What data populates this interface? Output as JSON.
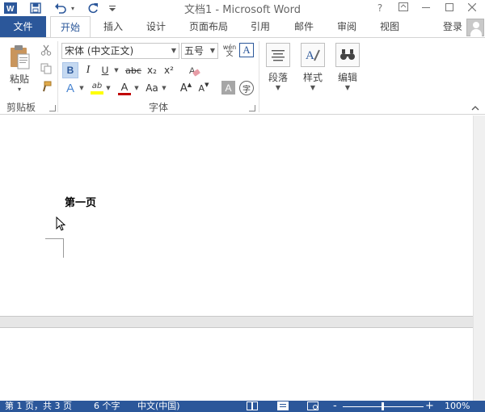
{
  "title_bar": {
    "title": "文档1 - Microsoft Word",
    "help": "?",
    "quick_access": [
      "word-app-icon",
      "save-icon",
      "undo-icon",
      "redo-icon",
      "customize-icon"
    ]
  },
  "tabs": {
    "file": "文件",
    "items": [
      "开始",
      "插入",
      "设计",
      "页面布局",
      "引用",
      "邮件",
      "审阅",
      "视图"
    ],
    "active": "开始",
    "login": "登录"
  },
  "ribbon": {
    "clipboard": {
      "paste": "粘贴",
      "label": "剪贴板"
    },
    "font": {
      "font_name": "宋体 (中文正文)",
      "font_size": "五号",
      "pinyin": "wén",
      "pinyin_sub": "文",
      "bold": "B",
      "italic": "I",
      "underline": "U",
      "strike": "abc",
      "subscript": "x₂",
      "superscript": "x²",
      "text_effect": "A",
      "highlight": "ab",
      "font_color": "A",
      "change_case": "Aa",
      "grow": "A",
      "shrink": "A",
      "char_shading": "A",
      "enclose": "字",
      "label": "字体"
    },
    "paragraph": {
      "label": "段落"
    },
    "styles": {
      "label": "样式"
    },
    "editing": {
      "label": "编辑"
    }
  },
  "document": {
    "page1_text": "第一页"
  },
  "status_bar": {
    "page": "第 1 页，共 3 页",
    "words": "6 个字",
    "language": "中文(中国)",
    "zoom_minus": "-",
    "zoom_plus": "+",
    "zoom": "100%"
  },
  "colors": {
    "accent": "#2b579a",
    "font_color_bar": "#c00000",
    "highlight_bar": "#ffff00"
  }
}
